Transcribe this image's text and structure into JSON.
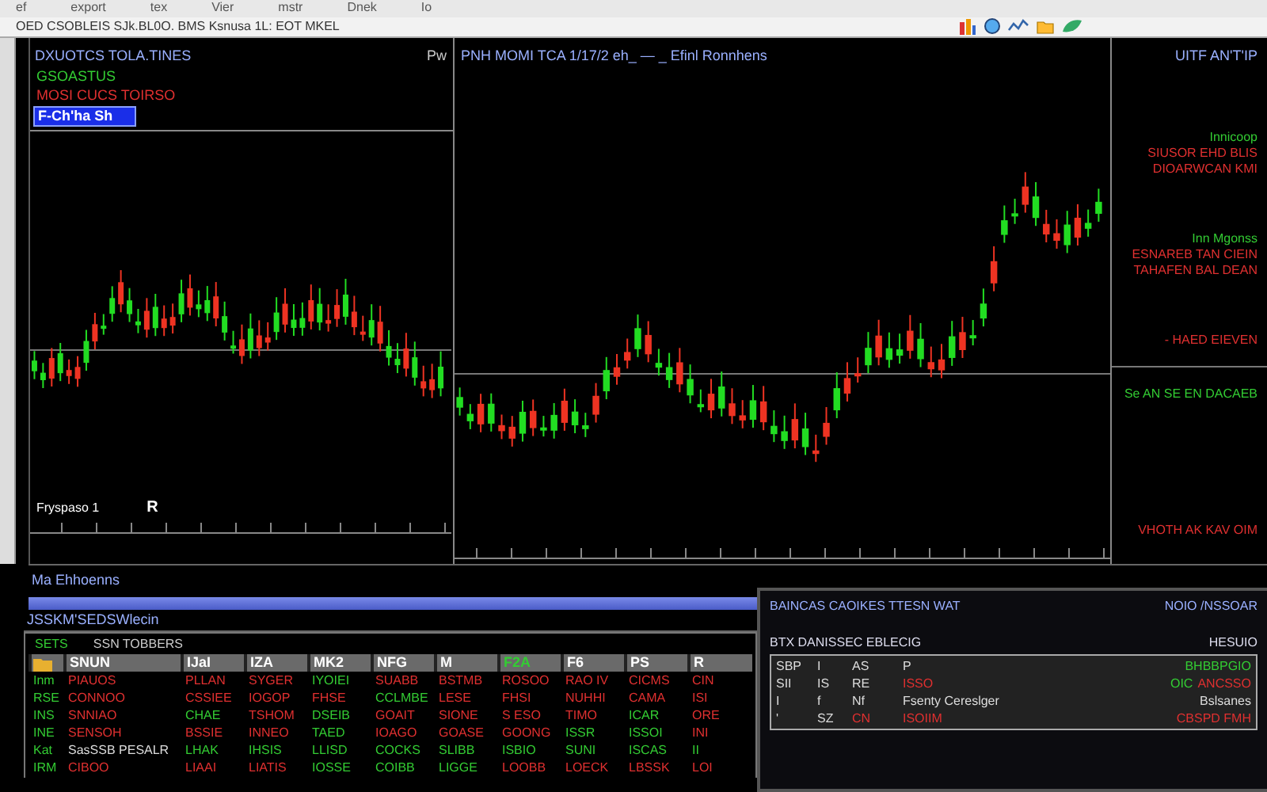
{
  "menu": [
    "ef",
    "export",
    "tex",
    "Vier",
    "mstr",
    "Dnek",
    "Io"
  ],
  "toolbar": {
    "text": "OED CSOBLEIS SJk.BL0O. BMS Ksnusa 1L: EOT MKEL"
  },
  "left_chart": {
    "title": "DXUOTCS TOLA.TINES",
    "tag": "Pw",
    "items": [
      {
        "label": "GSOASTUS",
        "color": "#33cc33",
        "selected": false
      },
      {
        "label": "MOSI CUCS TOIRSO",
        "color": "#e03030",
        "selected": false
      },
      {
        "label": "F-Ch'ha Sh",
        "color": "#ffffff",
        "selected": true
      }
    ],
    "footer": "Fryspaso 1",
    "marker": "R"
  },
  "main_chart": {
    "title": "PNH MOMI TCA 1/17/2 eh_ — _ Efinl Ronnhens"
  },
  "side_panel": {
    "title": "UITF AN'T'IP",
    "groups": [
      [
        {
          "text": "Innicoop",
          "color": "#33cc33"
        },
        {
          "text": "SIUSOR EHD BLIS",
          "color": "#e03030"
        },
        {
          "text": "DIOARWCAN KMI",
          "color": "#e03030"
        }
      ],
      [
        {
          "text": "Inn Mgonss",
          "color": "#33cc33"
        },
        {
          "text": "ESNAREB TAN CIEIN",
          "color": "#e03030"
        },
        {
          "text": "TAHAFEN BAL DEAN",
          "color": "#e03030"
        }
      ],
      [
        {
          "text": "- HAED EIEVEN",
          "color": "#e03030"
        }
      ],
      [
        {
          "text": "Se AN SE EN DACAEB",
          "color": "#33cc33"
        }
      ],
      [
        {
          "text": "VHOTH AK KAV OIM",
          "color": "#e03030"
        }
      ]
    ]
  },
  "info_bar": {
    "title": "Ma Ehhoenns"
  },
  "table": {
    "caption": "JSSKM'SEDSWlecin",
    "filter_label": "SETS",
    "filter_text": "SSN TOBBERS",
    "columns": [
      {
        "label": "SNUN",
        "highlighted": false
      },
      {
        "label": "IJaI",
        "highlighted": false
      },
      {
        "label": "IZA",
        "highlighted": false
      },
      {
        "label": "MK2",
        "highlighted": false
      },
      {
        "label": "NFG",
        "highlighted": false
      },
      {
        "label": "M",
        "highlighted": false
      },
      {
        "label": "F2A",
        "highlighted": true
      },
      {
        "label": "F6",
        "highlighted": false
      },
      {
        "label": "PS",
        "highlighted": false
      },
      {
        "label": "R",
        "highlighted": false
      }
    ],
    "rows": [
      {
        "label": "Inm",
        "cells": [
          {
            "text": "PIAUOS",
            "color": "#e03030"
          },
          {
            "text": "PLLAN",
            "color": "#e03030"
          },
          {
            "text": "SYGER",
            "color": "#e03030"
          },
          {
            "text": "IYOIEI",
            "color": "#33cc33"
          },
          {
            "text": "SUABB",
            "color": "#e03030"
          },
          {
            "text": "BSTMB",
            "color": "#e03030"
          },
          {
            "text": "ROSOO",
            "color": "#e03030"
          },
          {
            "text": "RAO IV",
            "color": "#e03030"
          },
          {
            "text": "CICMS",
            "color": "#e03030"
          },
          {
            "text": "CIN",
            "color": "#e03030"
          }
        ]
      },
      {
        "label": "RSE",
        "cells": [
          {
            "text": "CONNOO",
            "color": "#e03030"
          },
          {
            "text": "CSSIEE",
            "color": "#e03030"
          },
          {
            "text": "IOGOP",
            "color": "#e03030"
          },
          {
            "text": "FHSE",
            "color": "#e03030"
          },
          {
            "text": "CCLMBE",
            "color": "#33cc33"
          },
          {
            "text": "LESE",
            "color": "#e03030"
          },
          {
            "text": "FHSI",
            "color": "#e03030"
          },
          {
            "text": "NUHHI",
            "color": "#e03030"
          },
          {
            "text": "CAMA",
            "color": "#e03030"
          },
          {
            "text": "ISI",
            "color": "#e03030"
          }
        ]
      },
      {
        "label": "INS",
        "cells": [
          {
            "text": "SNNIAO",
            "color": "#e03030"
          },
          {
            "text": "CHAE",
            "color": "#33cc33"
          },
          {
            "text": "TSHOM",
            "color": "#e03030"
          },
          {
            "text": "DSEIB",
            "color": "#33cc33"
          },
          {
            "text": "GOAIT",
            "color": "#e03030"
          },
          {
            "text": "SIONE",
            "color": "#e03030"
          },
          {
            "text": "S ESO",
            "color": "#e03030"
          },
          {
            "text": "TIMO",
            "color": "#e03030"
          },
          {
            "text": "ICAR",
            "color": "#33cc33"
          },
          {
            "text": "ORE",
            "color": "#e03030"
          }
        ]
      },
      {
        "label": "INE",
        "cells": [
          {
            "text": "SENSOH",
            "color": "#e03030"
          },
          {
            "text": "BSSIE",
            "color": "#e03030"
          },
          {
            "text": "INNEO",
            "color": "#e03030"
          },
          {
            "text": "TAED",
            "color": "#33cc33"
          },
          {
            "text": "IOAGO",
            "color": "#e03030"
          },
          {
            "text": "GOASE",
            "color": "#e03030"
          },
          {
            "text": "GOONG",
            "color": "#e03030"
          },
          {
            "text": "ISSR",
            "color": "#33cc33"
          },
          {
            "text": "ISSOI",
            "color": "#33cc33"
          },
          {
            "text": "INI",
            "color": "#e03030"
          }
        ]
      },
      {
        "label": "Kat",
        "cells": [
          {
            "text": "SasSSB PESALR",
            "color": "#dddddd"
          },
          {
            "text": "LHAK",
            "color": "#33cc33"
          },
          {
            "text": "IHSIS",
            "color": "#33cc33"
          },
          {
            "text": "LLISD",
            "color": "#33cc33"
          },
          {
            "text": "COCKS",
            "color": "#33cc33"
          },
          {
            "text": "SLIBB",
            "color": "#33cc33"
          },
          {
            "text": "ISBIO",
            "color": "#33cc33"
          },
          {
            "text": "SUNI",
            "color": "#33cc33"
          },
          {
            "text": "ISCAS",
            "color": "#33cc33"
          },
          {
            "text": "II",
            "color": "#33cc33"
          }
        ]
      },
      {
        "label": "IRM",
        "cells": [
          {
            "text": "CIBOO",
            "color": "#e03030"
          },
          {
            "text": "LIAAI",
            "color": "#e03030"
          },
          {
            "text": "LIATIS",
            "color": "#e03030"
          },
          {
            "text": "IOSSE",
            "color": "#33cc33"
          },
          {
            "text": "COIBB",
            "color": "#33cc33"
          },
          {
            "text": "LIGGE",
            "color": "#33cc33"
          },
          {
            "text": "LOOBB",
            "color": "#e03030"
          },
          {
            "text": "LOECK",
            "color": "#e03030"
          },
          {
            "text": "LBSSK",
            "color": "#e03030"
          },
          {
            "text": "LOI",
            "color": "#e03030"
          }
        ]
      }
    ]
  },
  "order_panel": {
    "title": "BAINCAS CAOIKES TTESN WAT",
    "title_right": "NOIO /NSSOAR",
    "subtitle": "BTX DANISSEC EBLECIG",
    "subtitle_right": "HESUIO",
    "rows": [
      {
        "cells": [
          {
            "text": "SBP",
            "color": "#dddddd"
          },
          {
            "text": "I",
            "color": "#dddddd"
          },
          {
            "text": "AS",
            "color": "#dddddd"
          },
          {
            "text": "P",
            "color": "#dddddd"
          }
        ],
        "values": [
          {
            "text": "BHBBPGIO",
            "color": "#33cc33"
          }
        ]
      },
      {
        "cells": [
          {
            "text": "SII",
            "color": "#dddddd"
          },
          {
            "text": "IS",
            "color": "#dddddd"
          },
          {
            "text": "RE",
            "color": "#dddddd"
          },
          {
            "text": "ISSO",
            "color": "#e03030"
          }
        ],
        "values": [
          {
            "text": "OIC",
            "color": "#33cc33"
          },
          {
            "text": "ANCSSO",
            "color": "#e03030"
          }
        ]
      },
      {
        "cells": [
          {
            "text": "I",
            "color": "#dddddd"
          },
          {
            "text": "f",
            "color": "#dddddd"
          },
          {
            "text": "Nf",
            "color": "#dddddd"
          },
          {
            "text": "Fsenty Cereslger",
            "color": "#dddddd"
          }
        ],
        "values": [
          {
            "text": "Bslsanes",
            "color": "#dddddd"
          }
        ]
      },
      {
        "cells": [
          {
            "text": "'",
            "color": "#dddddd"
          },
          {
            "text": "SZ",
            "color": "#dddddd"
          },
          {
            "text": "CN",
            "color": "#e03030"
          },
          {
            "text": "ISOIIM",
            "color": "#e03030"
          }
        ],
        "values": [
          {
            "text": "CBSPD FMH",
            "color": "#e03030"
          }
        ]
      }
    ]
  }
}
